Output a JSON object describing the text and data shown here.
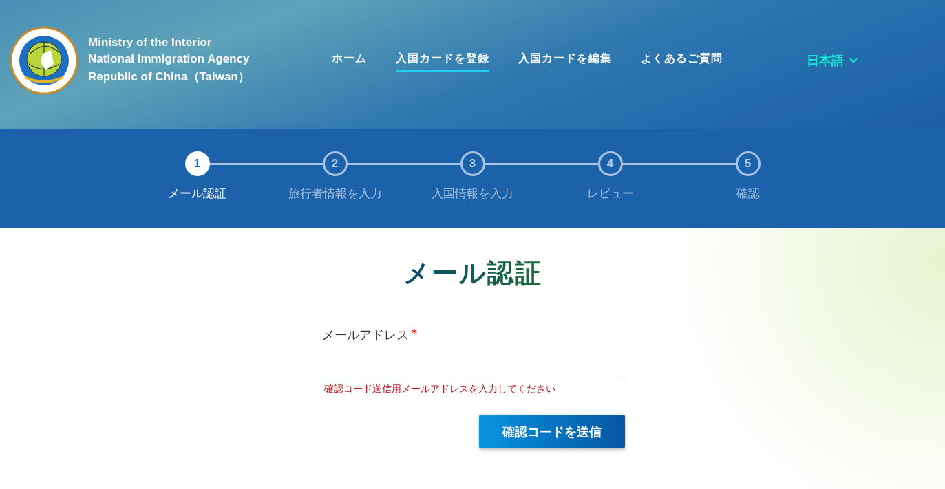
{
  "header": {
    "agency_lines": [
      "Ministry of the Interior",
      "National Immigration Agency",
      "Republic of China（Taiwan）"
    ],
    "nav": [
      {
        "label": "ホーム",
        "selected": false
      },
      {
        "label": "入国カードを登録",
        "selected": true
      },
      {
        "label": "入国カードを編集",
        "selected": false
      },
      {
        "label": "よくあるご質問",
        "selected": false
      }
    ],
    "language": "日本語"
  },
  "steps": [
    {
      "number": "1",
      "label": "メール認証",
      "selected": true
    },
    {
      "number": "2",
      "label": "旅行者情報を入力",
      "selected": false
    },
    {
      "number": "3",
      "label": "入国情報を入力",
      "selected": false
    },
    {
      "number": "4",
      "label": "レビュー",
      "selected": false
    },
    {
      "number": "5",
      "label": "確認",
      "selected": false
    }
  ],
  "form": {
    "title": "メール認証",
    "field_label": "メールアドレス",
    "required_mark": "*",
    "hint": "確認コード送信用メールアドレスを入力してください",
    "submit": "確認コードを送信"
  }
}
